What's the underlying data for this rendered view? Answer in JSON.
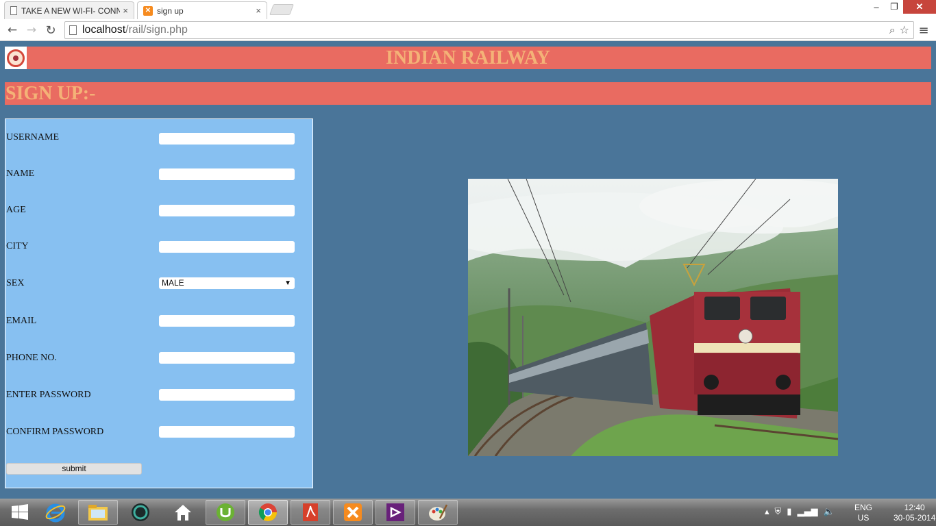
{
  "browser": {
    "tabs": [
      {
        "title": "TAKE A NEW WI-FI- CONN",
        "active": false,
        "icon": "document-icon"
      },
      {
        "title": "sign up",
        "active": true,
        "icon": "xampp-icon"
      }
    ],
    "tab_close_glyph": "×",
    "url_host": "localhost",
    "url_path": "/rail/sign.php"
  },
  "header": {
    "title": "INDIAN RAILWAY",
    "logo": "indian-railways-logo"
  },
  "signup": {
    "heading": "SIGN UP:-"
  },
  "form": {
    "fields": [
      {
        "label": "USERNAME",
        "value": ""
      },
      {
        "label": "NAME",
        "value": ""
      },
      {
        "label": "AGE",
        "value": ""
      },
      {
        "label": "CITY",
        "value": ""
      },
      {
        "label": "SEX",
        "type": "select",
        "value": "MALE"
      },
      {
        "label": "EMAIL",
        "value": ""
      },
      {
        "label": "PHONE NO.",
        "value": ""
      },
      {
        "label": "ENTER PASSWORD",
        "value": ""
      },
      {
        "label": "CONFIRM PASSWORD",
        "value": ""
      }
    ],
    "submit_label": "submit"
  },
  "image": {
    "subject": "red electric locomotive with passenger coaches on curved track, green hills and fog"
  },
  "taskbar": {
    "apps": [
      "start-icon",
      "internet-explorer-icon",
      "file-explorer-icon",
      "app-circle-icon",
      "home-icon",
      "utorrent-icon",
      "chrome-icon",
      "acrobat-icon",
      "xampp-icon",
      "visual-studio-icon",
      "paint-icon"
    ],
    "language_top": "ENG",
    "language_bottom": "US",
    "time": "12:40",
    "date": "30-05-2014"
  },
  "colors": {
    "page_bg": "#4a7599",
    "banner": "#e96b61",
    "banner_text": "#f4b277",
    "form_bg": "#87c0f1"
  }
}
